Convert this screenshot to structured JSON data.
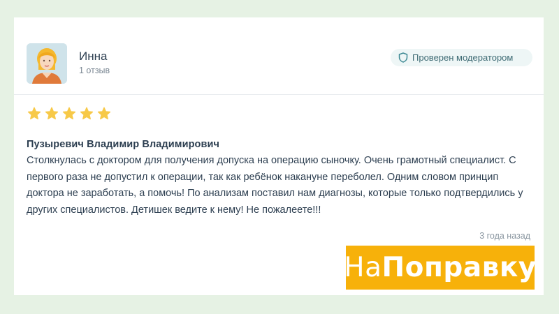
{
  "review": {
    "user": {
      "name": "Инна",
      "reviews_count": "1 отзыв",
      "avatar_icon": "woman-avatar-icon"
    },
    "badge": {
      "label": "Проверен модератором",
      "icon": "shield-icon",
      "color": "#3e6b74"
    },
    "rating": {
      "stars": 5,
      "max": 5,
      "color": "#f7c948"
    },
    "doctor_name": "Пузыревич Владимир Владимирович",
    "text": "Столкнулась с доктором для получения допуска на операцию сыночку. Очень грамотный специалист. С первого раза не допустил к операции, так как ребёнок накануне переболел. Одним словом принцип доктора не заработать, а помочь! По анализам поставил нам диагнозы, которые только подтвердились у других специалистов. Детишек ведите к нему! Не пожалеете!!!",
    "time_ago": "3 года назад"
  },
  "logo": {
    "part1": "На",
    "part2": "Поправку",
    "background": "#f7b10a"
  }
}
